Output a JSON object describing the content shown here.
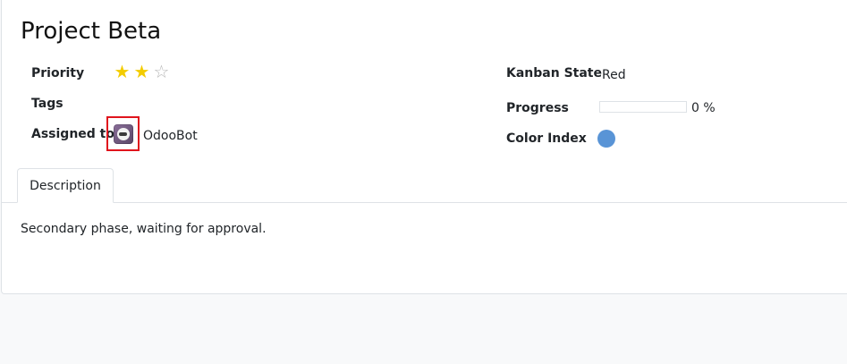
{
  "record": {
    "title": "Project Beta"
  },
  "fields": {
    "priority": {
      "label": "Priority",
      "stars_total": 3,
      "stars_filled": 2
    },
    "tags": {
      "label": "Tags"
    },
    "assigned_to": {
      "label": "Assigned to",
      "user": "OdooBot"
    },
    "kanban_state": {
      "label": "Kanban State",
      "value": "Red"
    },
    "progress": {
      "label": "Progress",
      "text": "0 %",
      "fraction": 0.0
    },
    "color_index": {
      "label": "Color Index",
      "color": "#5994d6"
    }
  },
  "tabs": [
    {
      "label": "Description",
      "active": true
    }
  ],
  "description": "Secondary phase, waiting for approval.",
  "icons": {
    "star_on": "★",
    "star_off": "☆"
  },
  "colors": {
    "star_active": "#f3cc00",
    "highlight_box": "#e0141d"
  }
}
